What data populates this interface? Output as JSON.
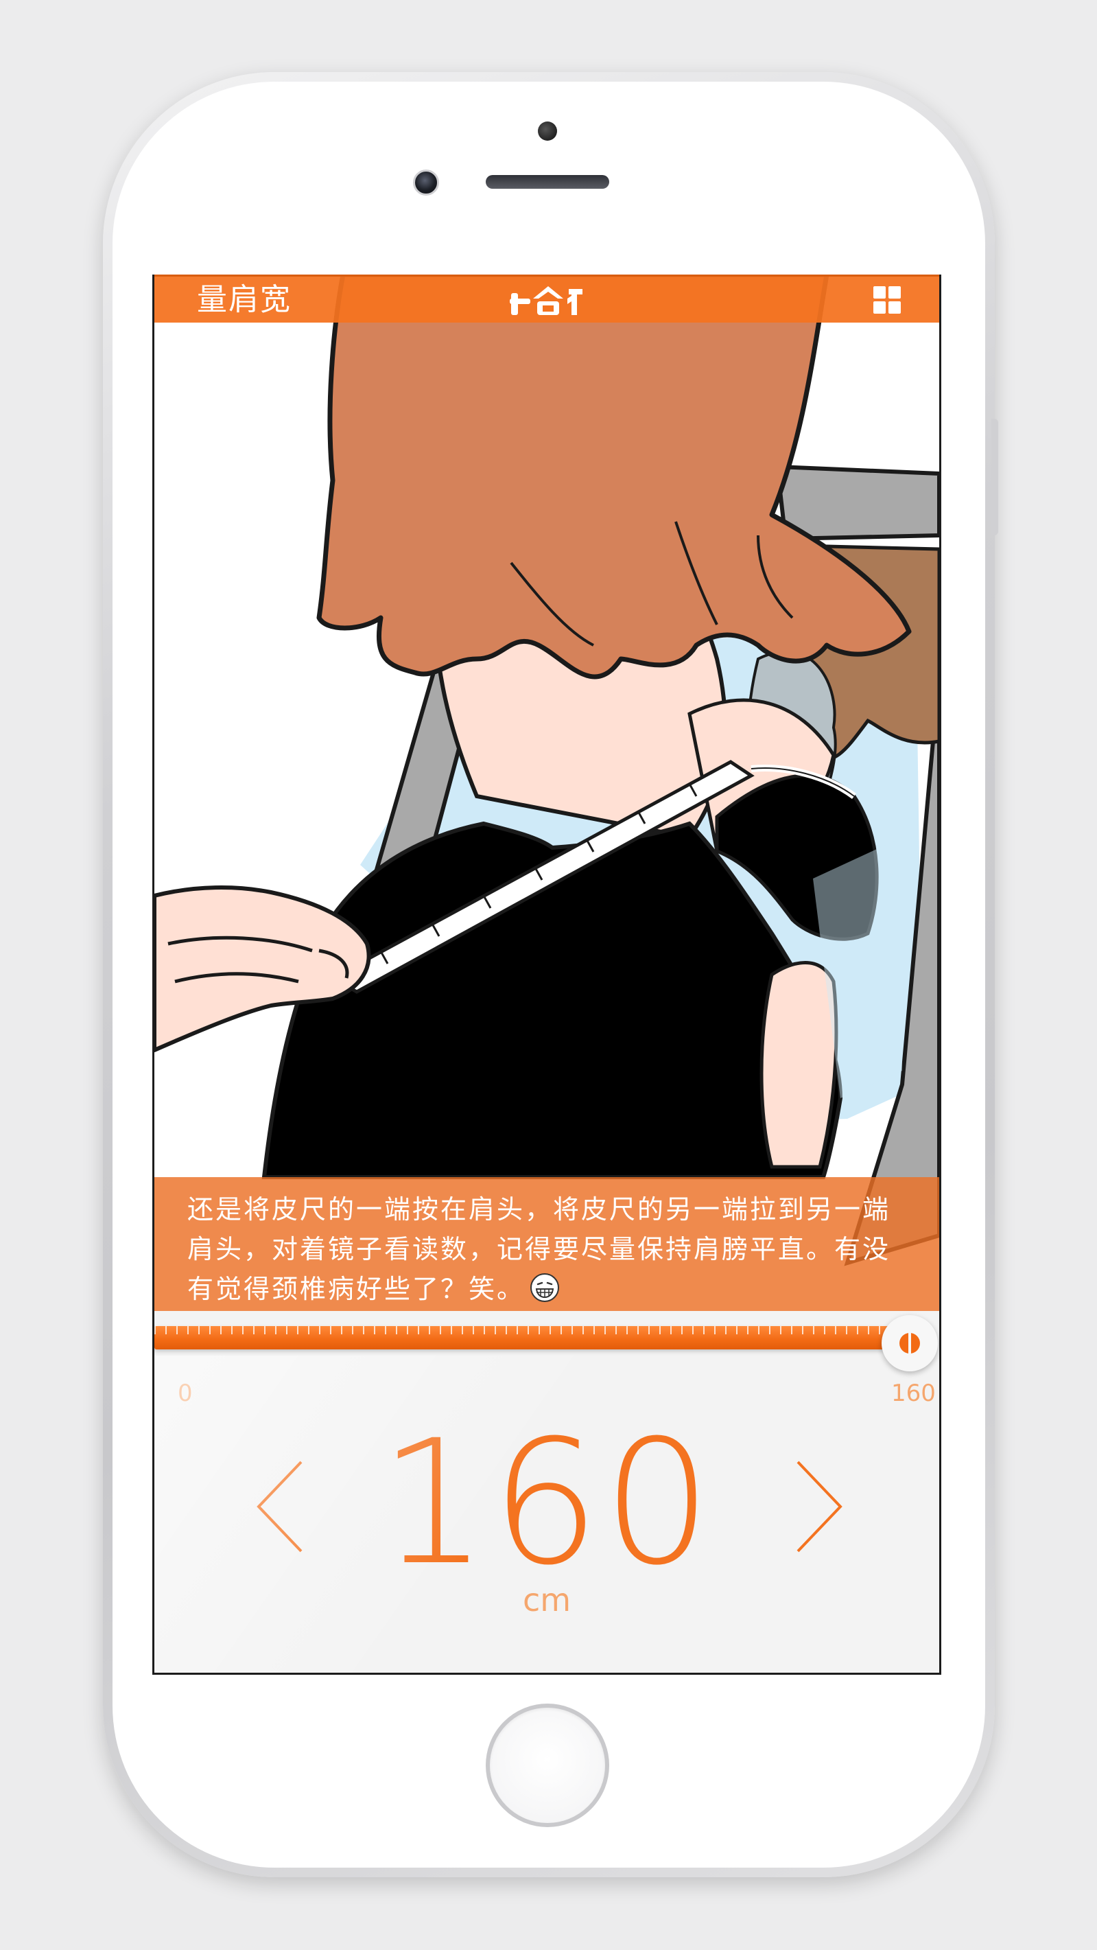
{
  "header": {
    "title": "量肩宽",
    "logo_text": "拾衣",
    "menu_icon": "grid-menu-icon"
  },
  "caption": {
    "text": "还是将皮尺的一端按在肩头，将皮尺的另一端拉到另一端肩头，对着镜子看读数，记得要尽量保持肩膀平直。有没有觉得颈椎病好些了？笑。",
    "emoji": "grin-face-icon"
  },
  "slider": {
    "min_label": "0",
    "max_label": "160",
    "value_fraction": 1.0
  },
  "measurement": {
    "value": "160",
    "unit": "cm",
    "prev_icon": "chevron-left-icon",
    "next_icon": "chevron-right-icon"
  },
  "colors": {
    "accent": "#f47320",
    "caption_bg": "#ec7026",
    "hair": "#d5825a",
    "shirt": "#000000",
    "skin": "#ffe0d4",
    "sky": "#cfeaf8"
  }
}
